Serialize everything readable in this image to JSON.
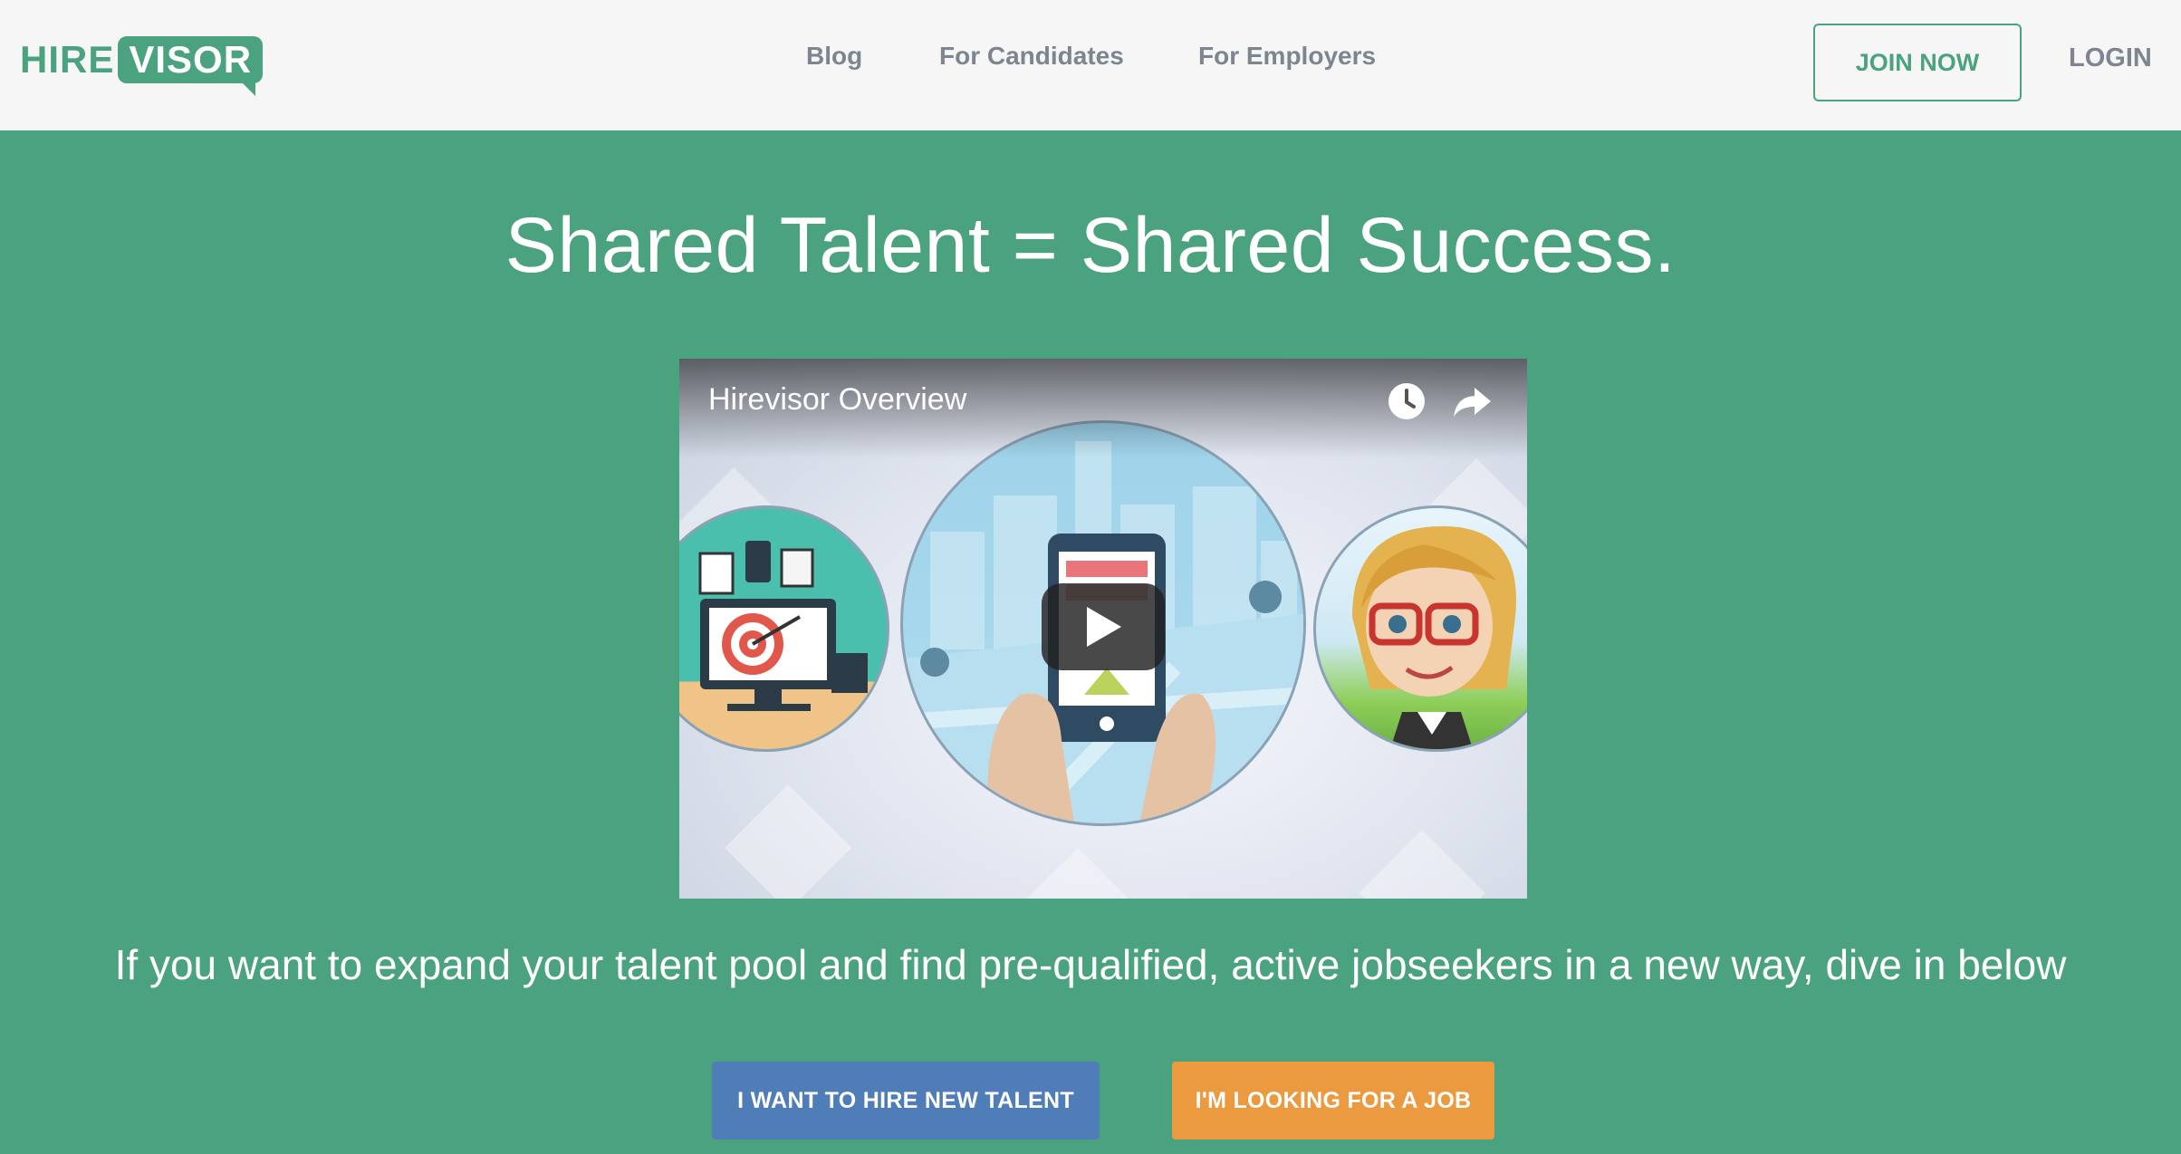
{
  "header": {
    "logo": {
      "part1": "HIRE",
      "part2": "VISOR"
    },
    "nav": [
      "Blog",
      "For Candidates",
      "For Employers"
    ],
    "join_label": "JOIN NOW",
    "login_label": "LOGIN"
  },
  "hero": {
    "title": "Shared Talent = Shared Success.",
    "video": {
      "title": "Hirevisor Overview"
    },
    "tagline": "If you want to expand your talent pool and find pre-qualified, active jobseekers in a new way, dive in below"
  },
  "cta": {
    "hire_label": "I WANT TO HIRE NEW TALENT",
    "job_label": "I'M LOOKING FOR A JOB"
  },
  "colors": {
    "brand_green": "#4aa37e",
    "header_bg": "#f6f6f6",
    "nav_text": "#7c8590",
    "hire_button": "#4f7db7",
    "job_button": "#eb9a3f"
  },
  "icons": [
    "watch-later-icon",
    "share-icon",
    "play-icon"
  ]
}
